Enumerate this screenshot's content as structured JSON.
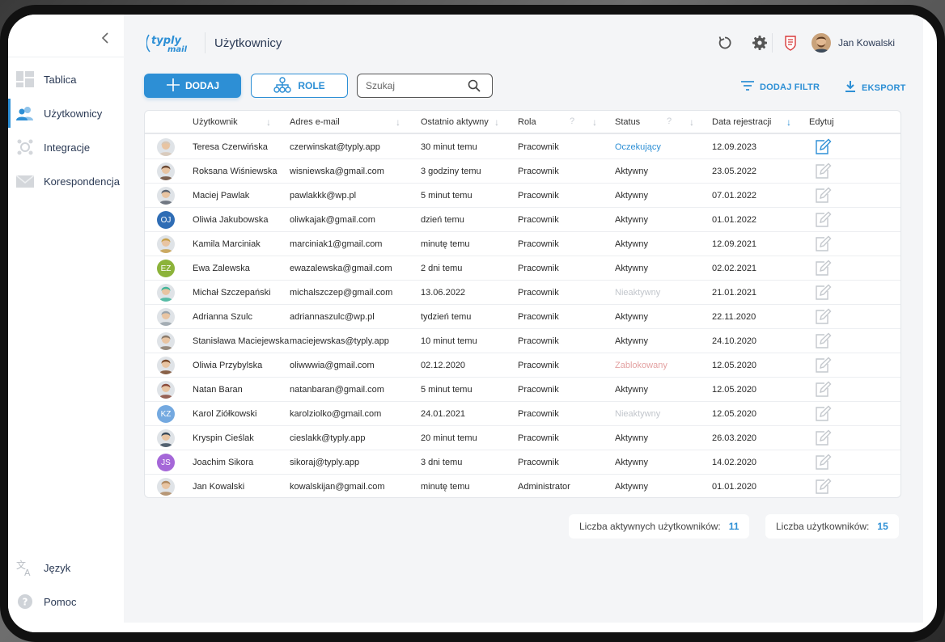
{
  "app": {
    "logo_text_top": "typly",
    "logo_text_bottom": "mail",
    "page_title": "Użytkownicy",
    "user_name": "Jan Kowalski",
    "accent": "#2d8fd5"
  },
  "sidebar": {
    "collapse_icon": "chevron-left-icon",
    "items": [
      {
        "label": "Tablica",
        "icon": "dashboard-icon"
      },
      {
        "label": "Użytkownicy",
        "icon": "users-icon",
        "active": true
      },
      {
        "label": "Integracje",
        "icon": "integrations-icon"
      },
      {
        "label": "Korespondencja",
        "icon": "mail-icon"
      }
    ],
    "bottom": [
      {
        "label": "Język",
        "icon": "language-icon"
      },
      {
        "label": "Pomoc",
        "icon": "help-icon"
      }
    ]
  },
  "toolbar": {
    "add_label": "DODAJ",
    "role_label": "ROLE",
    "search_placeholder": "Szukaj",
    "filter_label": "DODAJ FILTR",
    "export_label": "EKSPORT"
  },
  "table": {
    "headers": {
      "user": "Użytkownik",
      "email": "Adres e-mail",
      "last_active": "Ostatnio aktywny",
      "role": "Rola",
      "status": "Status",
      "registered": "Data rejestracji",
      "edit": "Edytuj"
    },
    "rows": [
      {
        "name": "Teresa Czerwińska",
        "email": "czerwinskat@typly.app",
        "last": "30 minut temu",
        "role": "Pracownik",
        "status": "Oczekujący",
        "status_type": "pending",
        "date": "12.09.2023",
        "avatar": "photo",
        "color": "#d8c7b5"
      },
      {
        "name": "Roksana Wiśniewska",
        "email": "wisniewska@gmail.com",
        "last": "3 godziny temu",
        "role": "Pracownik",
        "status": "Aktywny",
        "status_type": "active",
        "date": "23.05.2022",
        "avatar": "photo",
        "color": "#6b4a35"
      },
      {
        "name": "Maciej Pawlak",
        "email": "pawlakkk@wp.pl",
        "last": "5 minut temu",
        "role": "Pracownik",
        "status": "Aktywny",
        "status_type": "active",
        "date": "07.01.2022",
        "avatar": "photo",
        "color": "#5d6470"
      },
      {
        "name": "Oliwia Jakubowska",
        "email": "oliwkajak@gmail.com",
        "last": "dzień temu",
        "role": "Pracownik",
        "status": "Aktywny",
        "status_type": "active",
        "date": "01.01.2022",
        "avatar": "initials",
        "initials": "OJ",
        "color": "#2f6db5"
      },
      {
        "name": "Kamila Marciniak",
        "email": "marciniak1@gmail.com",
        "last": "minutę temu",
        "role": "Pracownik",
        "status": "Aktywny",
        "status_type": "active",
        "date": "12.09.2021",
        "avatar": "photo",
        "color": "#c8a04a"
      },
      {
        "name": "Ewa Zalewska",
        "email": "ewazalewska@gmail.com",
        "last": "2 dni temu",
        "role": "Pracownik",
        "status": "Aktywny",
        "status_type": "active",
        "date": "02.02.2021",
        "avatar": "initials",
        "initials": "EZ",
        "color": "#8cb33a"
      },
      {
        "name": "Michał Szczepański",
        "email": "michalszczep@gmail.com",
        "last": "13.06.2022",
        "role": "Pracownik",
        "status": "Nieaktywny",
        "status_type": "inactive",
        "date": "21.01.2021",
        "avatar": "photo",
        "color": "#3fb59a"
      },
      {
        "name": "Adrianna Szulc",
        "email": "adriannaszulc@wp.pl",
        "last": "tydzień temu",
        "role": "Pracownik",
        "status": "Aktywny",
        "status_type": "active",
        "date": "22.11.2020",
        "avatar": "photo",
        "color": "#9aa3aa"
      },
      {
        "name": "Stanisława Maciejewska",
        "email": "maciejewskas@typly.app",
        "last": "10 minut temu",
        "role": "Pracownik",
        "status": "Aktywny",
        "status_type": "active",
        "date": "24.10.2020",
        "avatar": "photo",
        "color": "#8a7a6a"
      },
      {
        "name": "Oliwia Przybylska",
        "email": "oliwwwia@gmail.com",
        "last": "02.12.2020",
        "role": "Pracownik",
        "status": "Zablokowany",
        "status_type": "blocked",
        "date": "12.05.2020",
        "avatar": "photo",
        "color": "#7a4a2a"
      },
      {
        "name": "Natan Baran",
        "email": "natanbaran@gmail.com",
        "last": "5 minut temu",
        "role": "Pracownik",
        "status": "Aktywny",
        "status_type": "active",
        "date": "12.05.2020",
        "avatar": "photo",
        "color": "#8a4a3a"
      },
      {
        "name": "Karol Ziółkowski",
        "email": "karolziolko@gmail.com",
        "last": "24.01.2021",
        "role": "Pracownik",
        "status": "Nieaktywny",
        "status_type": "inactive",
        "date": "12.05.2020",
        "avatar": "initials",
        "initials": "KZ",
        "color": "#74a9e0"
      },
      {
        "name": "Kryspin Cieślak",
        "email": "cieslakk@typly.app",
        "last": "20 minut temu",
        "role": "Pracownik",
        "status": "Aktywny",
        "status_type": "active",
        "date": "26.03.2020",
        "avatar": "photo",
        "color": "#3a4a5a"
      },
      {
        "name": "Joachim Sikora",
        "email": "sikoraj@typly.app",
        "last": "3 dni temu",
        "role": "Pracownik",
        "status": "Aktywny",
        "status_type": "active",
        "date": "14.02.2020",
        "avatar": "initials",
        "initials": "JS",
        "color": "#a567d8"
      },
      {
        "name": "Jan Kowalski",
        "email": "kowalskijan@gmail.com",
        "last": "minutę temu",
        "role": "Administrator",
        "status": "Aktywny",
        "status_type": "active",
        "date": "01.01.2020",
        "avatar": "photo",
        "color": "#b08a62"
      }
    ]
  },
  "stats": {
    "active_label": "Liczba aktywnych użytkowników:",
    "active_value": "11",
    "total_label": "Liczba użytkowników:",
    "total_value": "15"
  }
}
